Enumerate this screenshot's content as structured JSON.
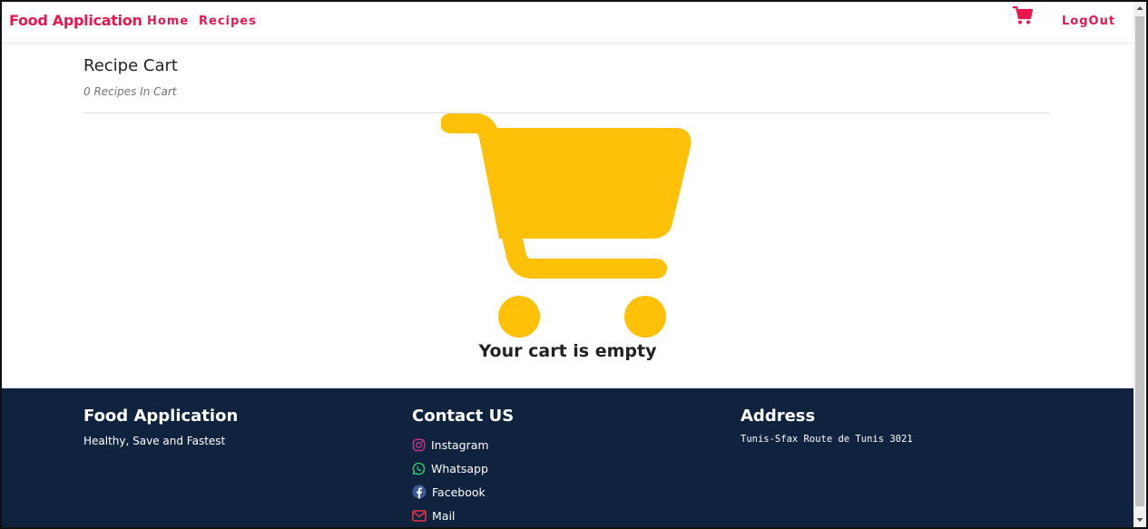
{
  "navbar": {
    "brand": "Food Application",
    "links": [
      {
        "label": "Home"
      },
      {
        "label": "Recipes"
      }
    ],
    "cart_icon": "shopping-cart-icon",
    "logout_label": "LogOut"
  },
  "main": {
    "title": "Recipe Cart",
    "count_text": "0 Recipes In Cart",
    "cart_icon": "shopping-cart-icon",
    "empty_message": "Your cart is empty"
  },
  "footer": {
    "about": {
      "heading": "Food Application",
      "tagline": "Healthy, Save and Fastest"
    },
    "contact": {
      "heading": "Contact US",
      "items": [
        {
          "label": "Instagram",
          "icon": "instagram-icon",
          "color": "#c13584"
        },
        {
          "label": "Whatsapp",
          "icon": "whatsapp-icon",
          "color": "#25d366"
        },
        {
          "label": "Facebook",
          "icon": "facebook-icon",
          "color": "#3b5998"
        },
        {
          "label": "Mail",
          "icon": "mail-icon",
          "color": "#dc3545"
        }
      ]
    },
    "address": {
      "heading": "Address",
      "text": "Tunis-Sfax Route de Tunis 3021"
    }
  },
  "colors": {
    "brand": "#e8174f",
    "cart": "#ffc107",
    "footer_bg": "#10233e"
  }
}
